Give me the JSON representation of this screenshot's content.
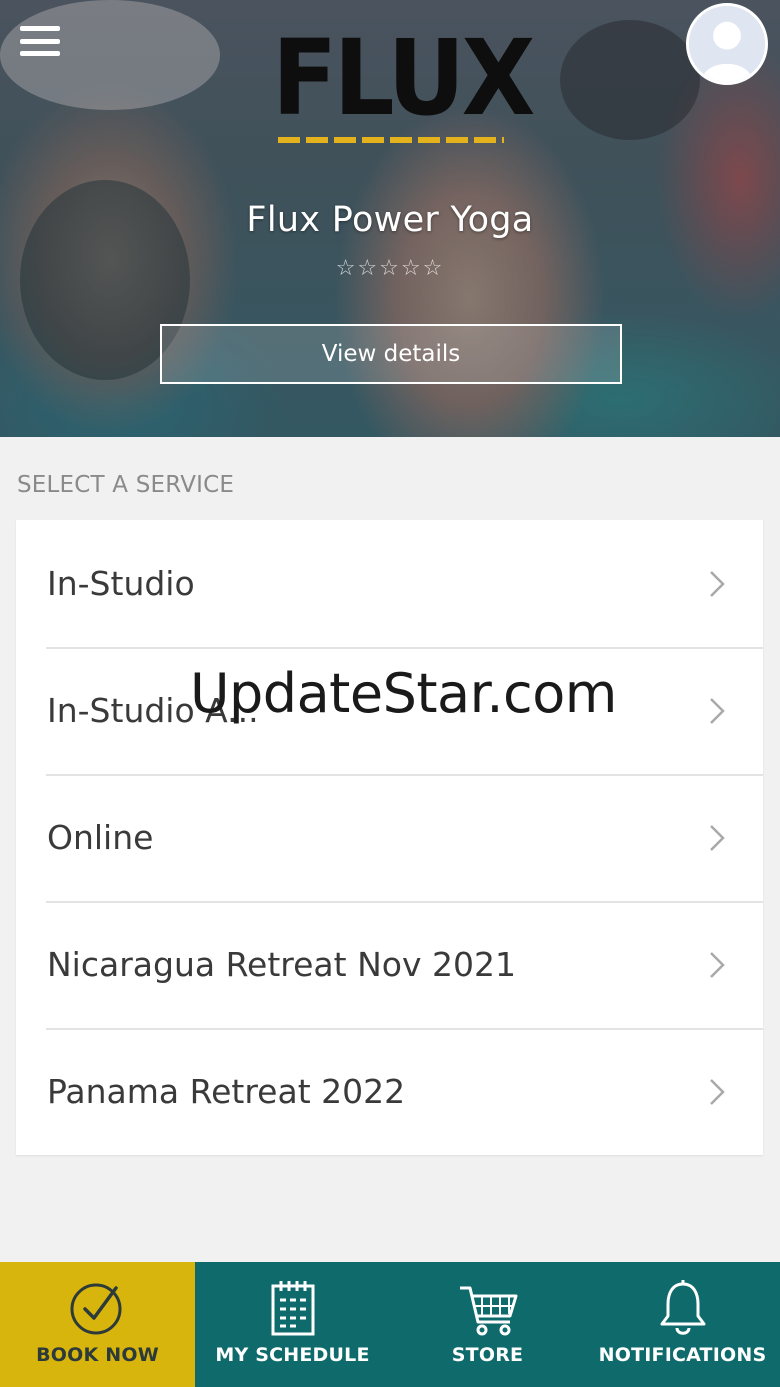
{
  "header": {
    "logo_text": "FLUX",
    "menu_icon": "hamburger-menu-icon",
    "avatar_icon": "user-avatar-icon"
  },
  "studio": {
    "name": "Flux Power Yoga",
    "rating_display": "☆☆☆☆☆",
    "rating": 0,
    "view_details_label": "View details"
  },
  "services": {
    "section_label": "SELECT A SERVICE",
    "items": [
      {
        "label": "In-Studio"
      },
      {
        "label": "In-Studio A..."
      },
      {
        "label": "Online"
      },
      {
        "label": "Nicaragua Retreat Nov 2021"
      },
      {
        "label": "Panama Retreat 2022"
      }
    ]
  },
  "watermark": "UpdateStar.com",
  "bottom_nav": {
    "items": [
      {
        "label": "BOOK NOW",
        "icon": "check-circle-icon",
        "active": true
      },
      {
        "label": "MY SCHEDULE",
        "icon": "calendar-icon",
        "active": false
      },
      {
        "label": "STORE",
        "icon": "cart-icon",
        "active": false
      },
      {
        "label": "NOTIFICATIONS",
        "icon": "bell-icon",
        "active": false
      }
    ]
  },
  "colors": {
    "nav_background": "#0f6b6b",
    "nav_active": "#d8b50d",
    "logo_accent": "#e3b21c",
    "page_background": "#f1f1f1"
  }
}
